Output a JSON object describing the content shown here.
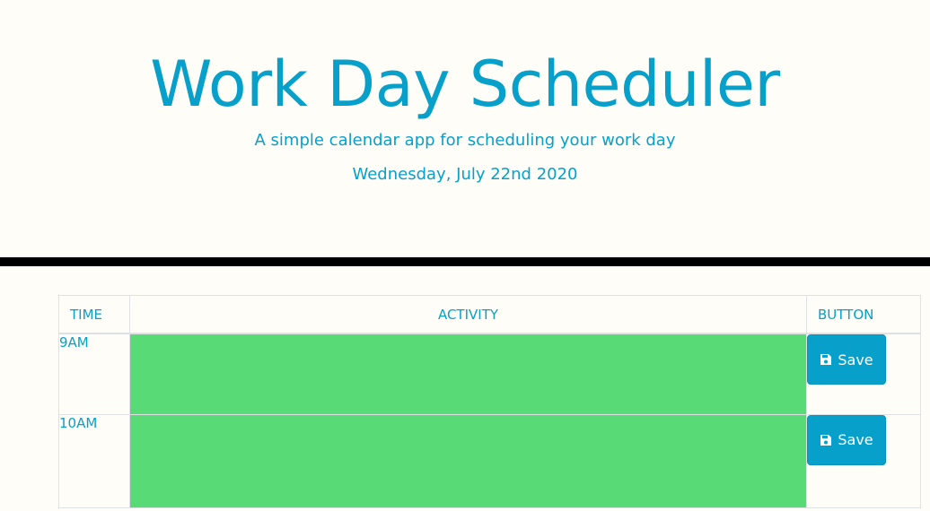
{
  "header": {
    "title": "Work Day Scheduler",
    "lead": "A simple calendar app for scheduling your work day",
    "current_date": "Wednesday, July 22nd 2020"
  },
  "table": {
    "columns": [
      "TIME",
      "ACTIVITY",
      "BUTTON"
    ],
    "rows": [
      {
        "time": "9AM",
        "activity": "",
        "button_label": "Save",
        "status": "future"
      },
      {
        "time": "10AM",
        "activity": "",
        "button_label": "Save",
        "status": "future"
      }
    ]
  },
  "colors": {
    "accent": "#06a0cb",
    "future": "#58db77",
    "background": "#fffdf7"
  },
  "icons": {
    "save_icon": "floppy-disk"
  }
}
